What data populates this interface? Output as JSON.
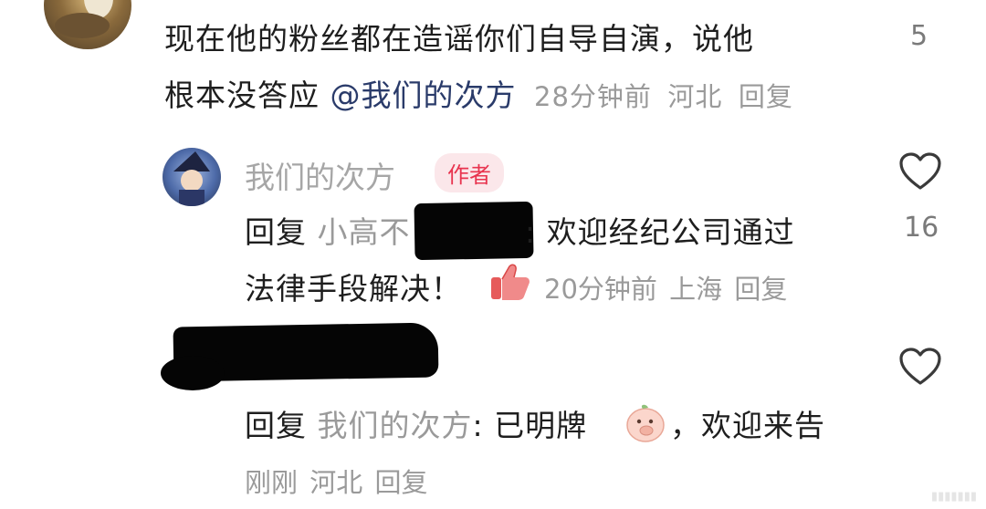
{
  "comment_top": {
    "text_line1": "现在他的粉丝都在造谣你们自导自演，说他",
    "text_line2": "根本没答应 ",
    "mention": "@我们的次方",
    "time": "28分钟前",
    "location": "河北",
    "reply_label": "回复",
    "like_count": "5"
  },
  "reply_author": {
    "username": "我们的次方",
    "badge": "作者",
    "reply_prefix": "回复",
    "reply_to": "小高不",
    "text_line1_after": ": 欢迎经纪公司通过",
    "text_line2": "法律手段解决！",
    "emoji_icon": "thumbs-up-emoji",
    "time": "20分钟前",
    "location": "上海",
    "reply_label": "回复",
    "like_count": "16"
  },
  "reply_second": {
    "reply_prefix": "回复",
    "reply_to": "我们的次方",
    "text_before_emoji": ": 已明牌",
    "emoji_icon": "peach-cover-mouth-emoji",
    "text_after_emoji": "，欢迎来告",
    "time": "刚刚",
    "location": "河北",
    "reply_label": "回复"
  },
  "colors": {
    "badge_bg": "#fbe7ea",
    "badge_text": "#e8344f",
    "meta_text": "#9a9a9a",
    "mention": "#2a3b6a"
  }
}
